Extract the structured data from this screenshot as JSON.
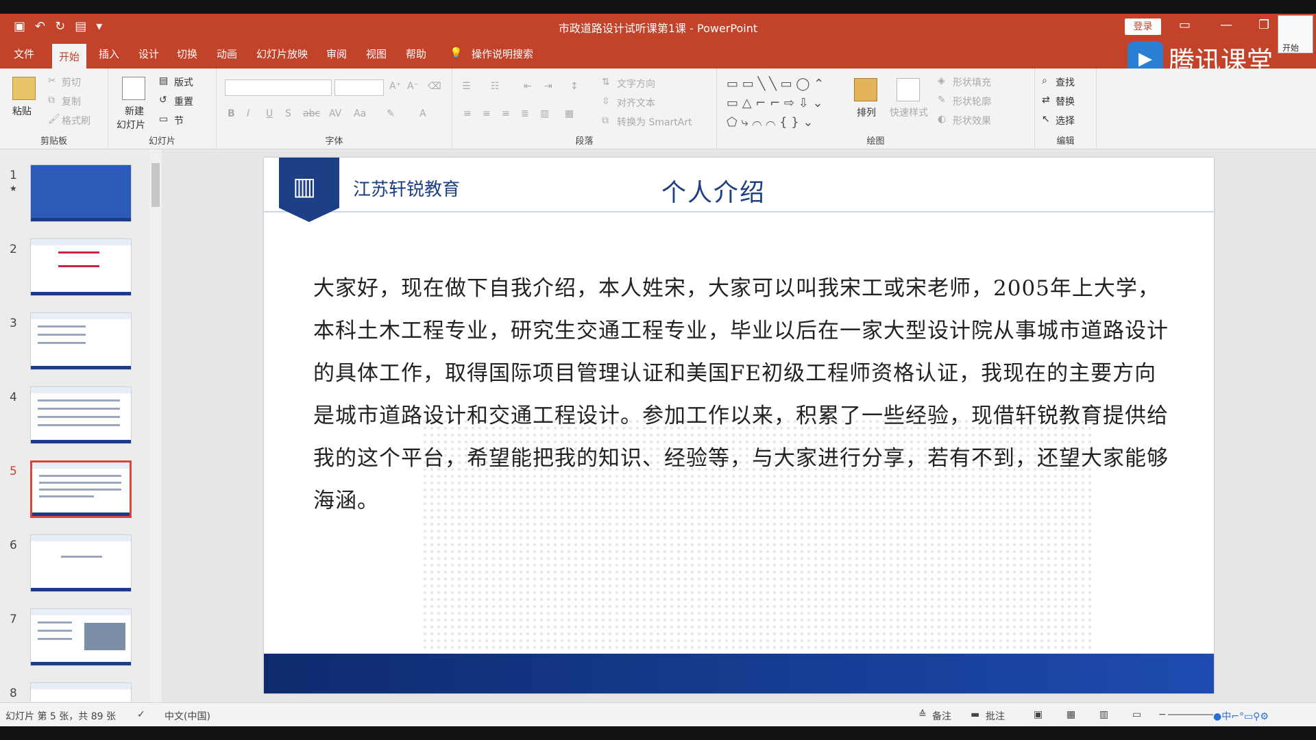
{
  "window": {
    "title": "市政道路设计试听课第1课 - PowerPoint",
    "login_label": "登录",
    "corner_label": "开始"
  },
  "tencent": {
    "label": "腾讯课堂"
  },
  "tabs": [
    {
      "label": "文件"
    },
    {
      "label": "开始"
    },
    {
      "label": "插入"
    },
    {
      "label": "设计"
    },
    {
      "label": "切换"
    },
    {
      "label": "动画"
    },
    {
      "label": "幻灯片放映"
    },
    {
      "label": "审阅"
    },
    {
      "label": "视图"
    },
    {
      "label": "帮助"
    },
    {
      "label": "操作说明搜索"
    }
  ],
  "ribbon": {
    "clipboard": {
      "label": "剪贴板",
      "paste": "粘贴",
      "cut": "剪切",
      "copy": "复制",
      "format_painter": "格式刷"
    },
    "slides": {
      "label": "幻灯片",
      "new_slide": "新建",
      "new_slide2": "幻灯片",
      "layout": "版式",
      "reset": "重置",
      "section": "节"
    },
    "font": {
      "label": "字体"
    },
    "paragraph": {
      "label": "段落",
      "text_direction": "文字方向",
      "align_text": "对齐文本",
      "smartart": "转换为 SmartArt"
    },
    "drawing": {
      "label": "绘图",
      "arrange": "排列",
      "quick_styles": "快速样式",
      "shape_fill": "形状填充",
      "shape_outline": "形状轮廓",
      "shape_effects": "形状效果"
    },
    "editing": {
      "label": "编辑",
      "find": "查找",
      "replace": "替换",
      "select": "选择"
    }
  },
  "thumbnails": [
    {
      "num": "1"
    },
    {
      "num": "2"
    },
    {
      "num": "3"
    },
    {
      "num": "4"
    },
    {
      "num": "5"
    },
    {
      "num": "6"
    },
    {
      "num": "7"
    },
    {
      "num": "8"
    }
  ],
  "slide": {
    "org_name": "江苏轩锐教育",
    "title": "个人介绍",
    "body": "大家好，现在做下自我介绍，本人姓宋，大家可以叫我宋工或宋老师，2005年上大学，本科土木工程专业，研究生交通工程专业，毕业以后在一家大型设计院从事城市道路设计的具体工作，取得国际项目管理认证和美国FE初级工程师资格认证，我现在的主要方向是城市道路设计和交通工程设计。参加工作以来，积累了一些经验，现借轩锐教育提供给我的这个平台，希望能把我的知识、经验等，与大家进行分享，若有不到，还望大家能够海涵。"
  },
  "status": {
    "slide_info": "幻灯片 第 5 张，共 89 张",
    "language": "中文(中国)",
    "notes": "备注",
    "comments": "批注"
  },
  "colors": {
    "accent": "#c2432a",
    "brand_blue": "#1d3f86"
  }
}
